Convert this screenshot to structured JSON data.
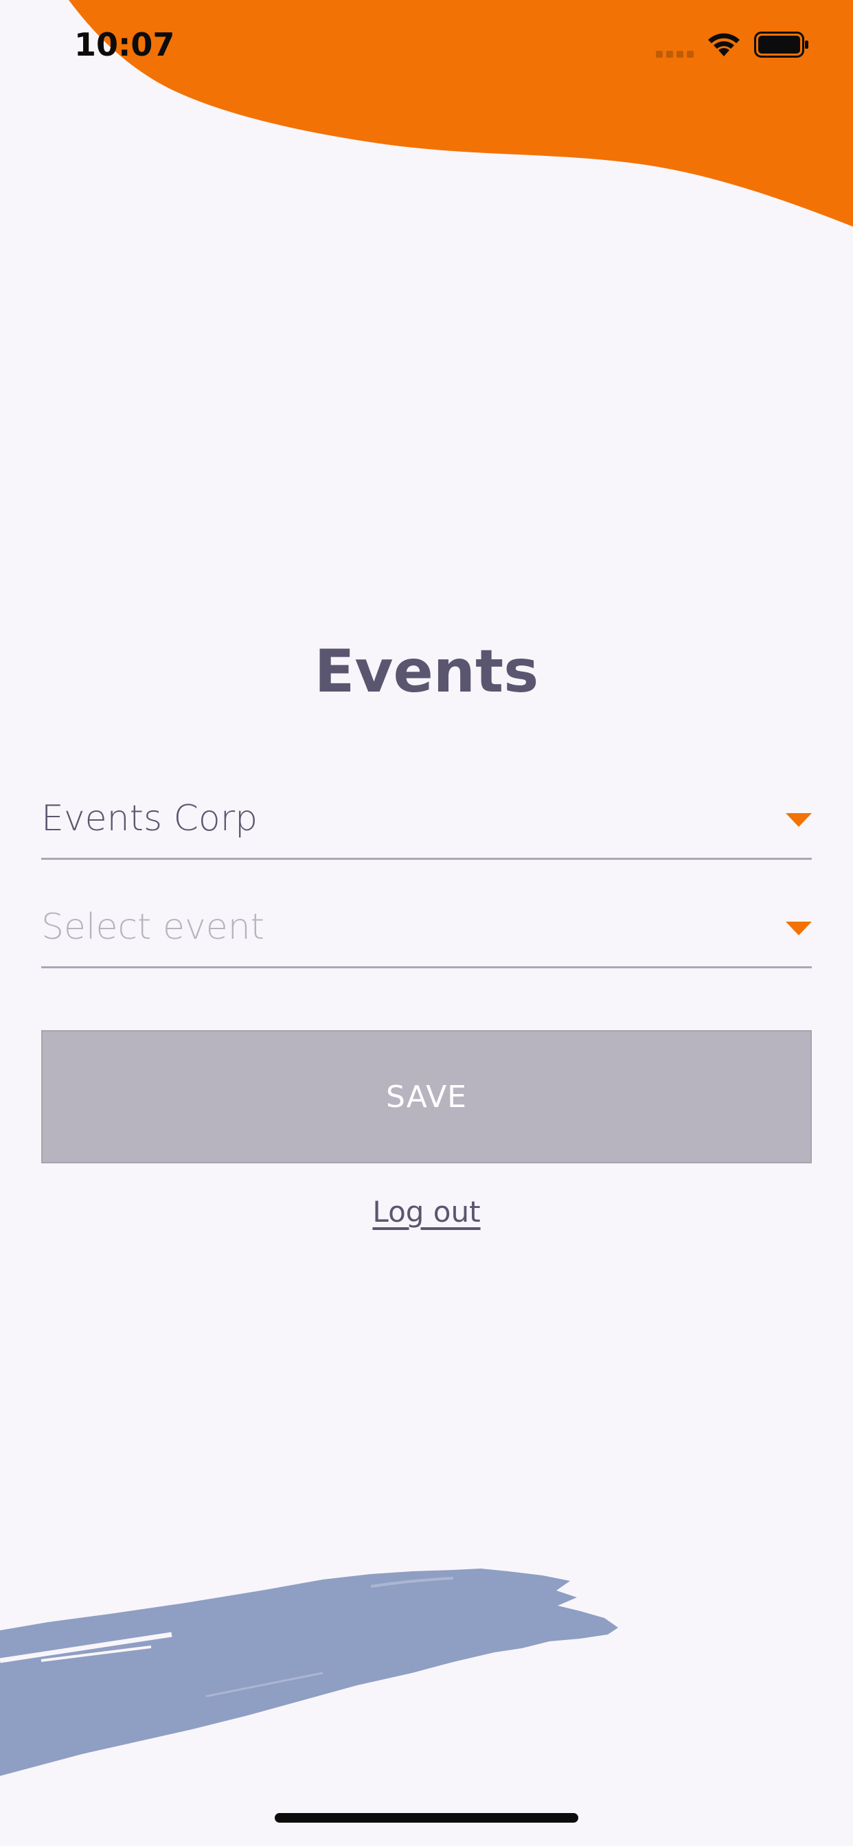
{
  "status_bar": {
    "time": "10:07"
  },
  "page": {
    "title": "Events"
  },
  "organization_select": {
    "value": "Events Corp"
  },
  "event_select": {
    "placeholder": "Select event"
  },
  "actions": {
    "save_label": "SAVE",
    "logout_label": "Log out"
  },
  "colors": {
    "accent_orange": "#f27205",
    "brush_blue": "#8f9ec3",
    "text_primary": "#5a5670",
    "text_placeholder": "#b7b4bf",
    "button_disabled": "#b7b4bf",
    "background": "#f8f6fa"
  },
  "icons": {
    "org_caret": "caret-down-icon",
    "event_caret": "caret-down-icon",
    "wifi": "wifi-icon",
    "battery": "battery-icon",
    "signal": "cellular-signal-icon"
  }
}
